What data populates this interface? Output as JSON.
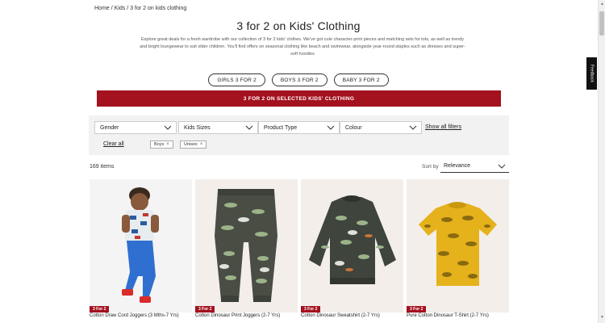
{
  "breadcrumb": {
    "home": "Home",
    "kids": "Kids",
    "current": "3 for 2 on kids clothing"
  },
  "page": {
    "title": "3 for 2 on Kids' Clothing",
    "description": "Explore great deals for a fresh wardrobe with our collection of 3 for 2 kids' clothes. We've got cute character-print pieces and matching sets for tots, as well as trendy and bright loungewear to suit older children. You'll find offers on seasonal clothing like beach and swimwear, alongside year-round staples such as dresses and super-soft hoodies"
  },
  "pills": [
    "GIRLS 3 FOR 2",
    "BOYS 3 FOR 2",
    "BABY 3 FOR 2"
  ],
  "banner": "3 FOR 2 ON SELECTED KIDS' CLOTHING",
  "filters": {
    "gender": "Gender",
    "sizes": "Kids Sizes",
    "product_type": "Product Type",
    "colour": "Colour",
    "show_all": "Show all filters",
    "clear_all": "Clear all",
    "chips": [
      "Boys",
      "Unisex"
    ]
  },
  "results": {
    "count": "169 items",
    "sort_label": "Sort by",
    "sort_value": "Relevance"
  },
  "products": [
    {
      "badge": "3 For 2",
      "name": "Cotton Draw Cord Joggers (3 Mths-7 Yrs)"
    },
    {
      "badge": "3 For 2",
      "name": "Cotton Dinosaur Print Joggers (2-7 Yrs)"
    },
    {
      "badge": "3 For 2",
      "name": "Cotton Dinosaur Sweatshirt (2-7 Yrs)"
    },
    {
      "badge": "3 For 2",
      "name": "Pure Cotton Dinosaur T-Shirt (2-7 Yrs)"
    }
  ],
  "feedback": "Feedback",
  "colors": {
    "brand_red": "#a4111f",
    "filter_bg": "#f2f2f2"
  }
}
